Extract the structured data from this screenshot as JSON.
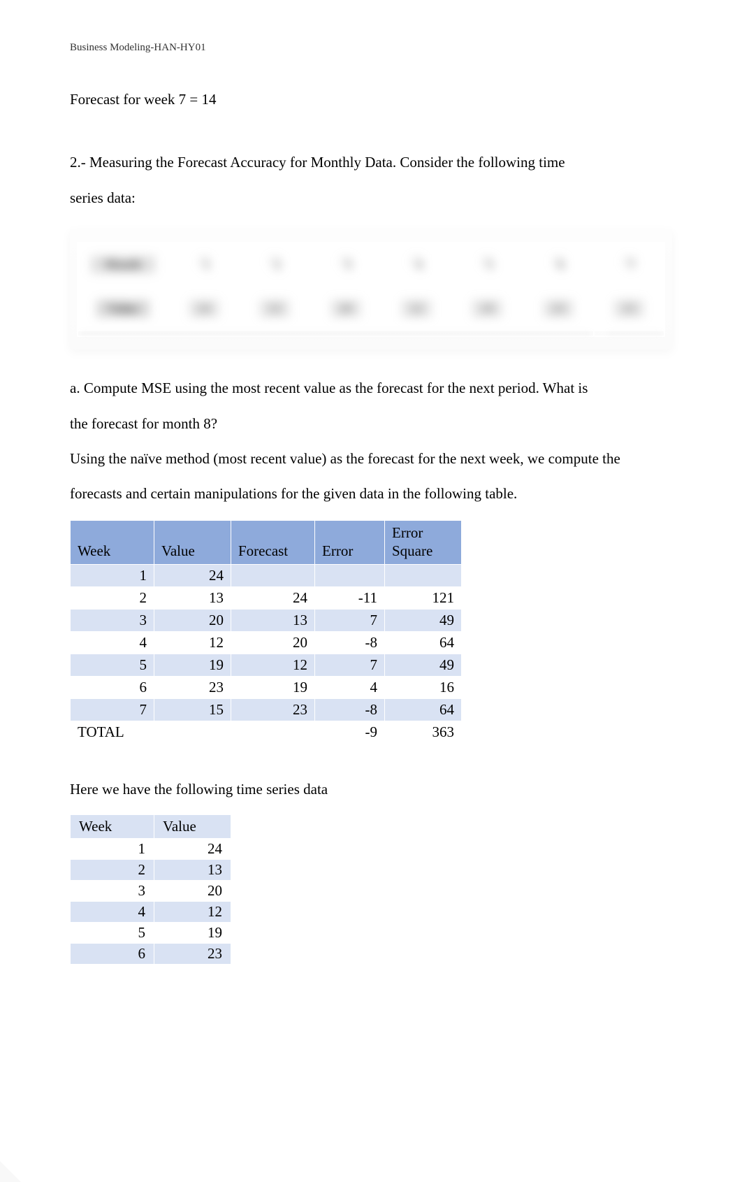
{
  "header": "Business Modeling-HAN-HY01",
  "forecast_line": "Forecast for week 7 = 14",
  "q2_intro_line1": "2.- Measuring the Forecast Accuracy for Monthly Data. Consider the following time",
  "q2_intro_line2": "series data:",
  "blurred_table": {
    "row1_label": "Month",
    "row1_cells": [
      "1",
      "2",
      "3",
      "4",
      "5",
      "6",
      "7"
    ],
    "row2_label": "Value",
    "row2_cells": [
      "24",
      "13",
      "20",
      "12",
      "19",
      "23",
      "15"
    ]
  },
  "qa_line1": "a. Compute MSE using the most recent value as the forecast for the next period. What is",
  "qa_line2": "the forecast for month 8?",
  "method_line1": "Using the naïve method (most recent value) as the forecast for the next week, we compute the",
  "method_line2": "forecasts and certain manipulations for the given data in the following table.",
  "calc_table": {
    "headers": {
      "week": "Week",
      "value": "Value",
      "forecast": "Forecast",
      "error": "Error",
      "error_square_l1": "Error",
      "error_square_l2": "Square"
    },
    "rows": [
      {
        "week": "1",
        "value": "24",
        "forecast": "",
        "error": "",
        "sq": ""
      },
      {
        "week": "2",
        "value": "13",
        "forecast": "24",
        "error": "-11",
        "sq": "121"
      },
      {
        "week": "3",
        "value": "20",
        "forecast": "13",
        "error": "7",
        "sq": "49"
      },
      {
        "week": "4",
        "value": "12",
        "forecast": "20",
        "error": "-8",
        "sq": "64"
      },
      {
        "week": "5",
        "value": "19",
        "forecast": "12",
        "error": "7",
        "sq": "49"
      },
      {
        "week": "6",
        "value": "23",
        "forecast": "19",
        "error": "4",
        "sq": "16"
      },
      {
        "week": "7",
        "value": "15",
        "forecast": "23",
        "error": "-8",
        "sq": "64"
      }
    ],
    "total_label": "TOTAL",
    "total_error": "-9",
    "total_sq": "363"
  },
  "ts_intro": "Here we have the following time series data",
  "ts_table": {
    "headers": {
      "week": "Week",
      "value": "Value"
    },
    "rows": [
      {
        "week": "1",
        "value": "24"
      },
      {
        "week": "2",
        "value": "13"
      },
      {
        "week": "3",
        "value": "20"
      },
      {
        "week": "4",
        "value": "12"
      },
      {
        "week": "5",
        "value": "19"
      },
      {
        "week": "6",
        "value": "23"
      }
    ]
  }
}
